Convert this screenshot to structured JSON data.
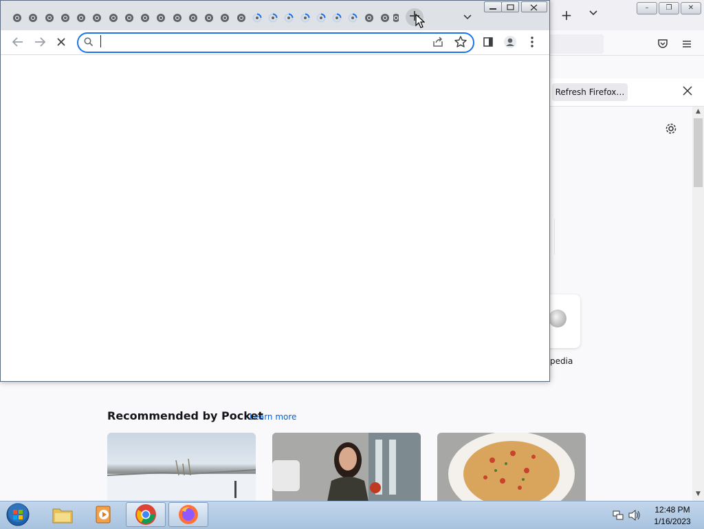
{
  "firefox": {
    "notification": {
      "refresh_label": "Refresh Firefox…"
    },
    "shortcut_label": "pedia",
    "pocket": {
      "title": "Recommended by Pocket",
      "learn_more": "Learn more"
    }
  },
  "chrome": {
    "omnibox": {
      "value": "",
      "placeholder": ""
    },
    "tab_count": 25
  },
  "taskbar": {
    "clock": {
      "time": "12:48 PM",
      "date": "1/16/2023"
    },
    "icons": [
      "start-orb-icon",
      "file-explorer-icon",
      "media-player-icon",
      "chrome-icon",
      "firefox-icon"
    ]
  },
  "colors": {
    "accent": "#1a73e8",
    "taskbar": "#b9cfe8",
    "firefox_link": "#0061e0"
  }
}
